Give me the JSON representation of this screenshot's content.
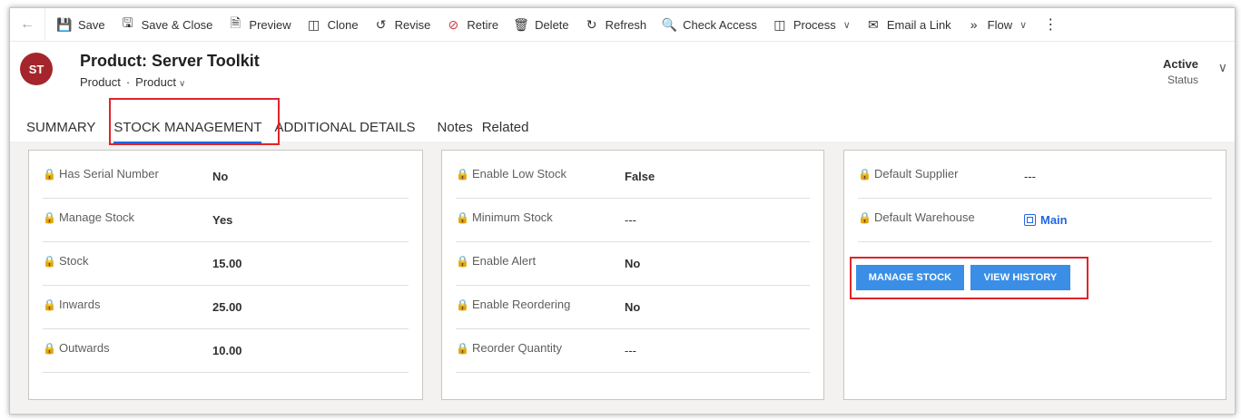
{
  "toolbar": {
    "back_icon": "back-arrow-icon",
    "items": [
      {
        "label": "Save",
        "icon": "save-icon"
      },
      {
        "label": "Save & Close",
        "icon": "save-close-icon"
      },
      {
        "label": "Preview",
        "icon": "preview-icon"
      },
      {
        "label": "Clone",
        "icon": "clone-icon"
      },
      {
        "label": "Revise",
        "icon": "revise-icon"
      },
      {
        "label": "Retire",
        "icon": "retire-icon"
      },
      {
        "label": "Delete",
        "icon": "delete-icon"
      },
      {
        "label": "Refresh",
        "icon": "refresh-icon"
      },
      {
        "label": "Check Access",
        "icon": "check-access-icon"
      },
      {
        "label": "Process",
        "icon": "process-icon"
      },
      {
        "label": "Email a Link",
        "icon": "email-icon"
      },
      {
        "label": "Flow",
        "icon": "flow-icon"
      }
    ],
    "more_icon": "more-vertical-icon"
  },
  "header": {
    "avatar_initials": "ST",
    "avatar_color": "#a4262c",
    "title": "Product: Server Toolkit",
    "entity": "Product",
    "form": "Product",
    "status_value": "Active",
    "status_label": "Status"
  },
  "tabs": [
    "SUMMARY",
    "STOCK MANAGEMENT",
    "ADDITIONAL DETAILS",
    "Notes",
    "Related"
  ],
  "selected_tab": "STOCK MANAGEMENT",
  "columns": {
    "left": [
      {
        "label": "Has Serial Number",
        "value": "No"
      },
      {
        "label": "Manage Stock",
        "value": "Yes"
      },
      {
        "label": "Stock",
        "value": "15.00"
      },
      {
        "label": "Inwards",
        "value": "25.00"
      },
      {
        "label": "Outwards",
        "value": "10.00"
      }
    ],
    "middle": [
      {
        "label": "Enable Low Stock",
        "value": "False"
      },
      {
        "label": "Minimum Stock",
        "value": "---"
      },
      {
        "label": "Enable Alert",
        "value": "No"
      },
      {
        "label": "Enable Reordering",
        "value": "No"
      },
      {
        "label": "Reorder Quantity",
        "value": "---"
      }
    ],
    "right": [
      {
        "label": "Default Supplier",
        "value": "---"
      },
      {
        "label": "Default Warehouse",
        "value": "Main"
      }
    ]
  },
  "buttons": {
    "manage_stock": "MANAGE STOCK",
    "view_history": "VIEW HISTORY"
  },
  "colors": {
    "accent": "#2266e3",
    "button": "#3a8ee6",
    "highlight": "#e0242a"
  }
}
